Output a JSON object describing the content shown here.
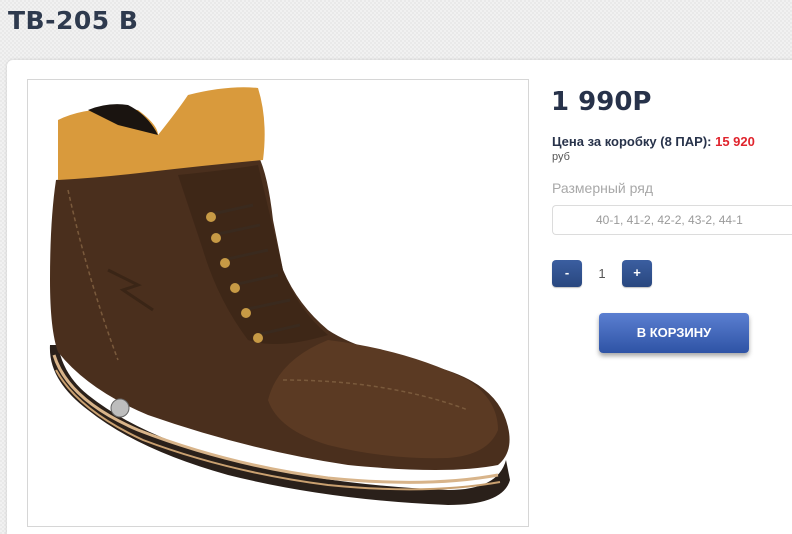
{
  "product": {
    "title": "TB-205 B",
    "price": "1 990Р",
    "box_price_label": "Цена за коробку (8 ПАР): ",
    "box_price_value": "15 920",
    "currency": "руб",
    "image_alt": "brown leather lace-up boot"
  },
  "size_row": {
    "label": "Размерный ряд",
    "value": "40-1, 41-2, 42-2, 43-2, 44-1"
  },
  "quantity": {
    "minus_label": "-",
    "value": "1",
    "plus_label": "+"
  },
  "cart": {
    "button_label": "В КОРЗИНУ"
  },
  "colors": {
    "accent_blue": "#2e53a5",
    "price_red": "#e0242d",
    "title_dark": "#27324a"
  }
}
